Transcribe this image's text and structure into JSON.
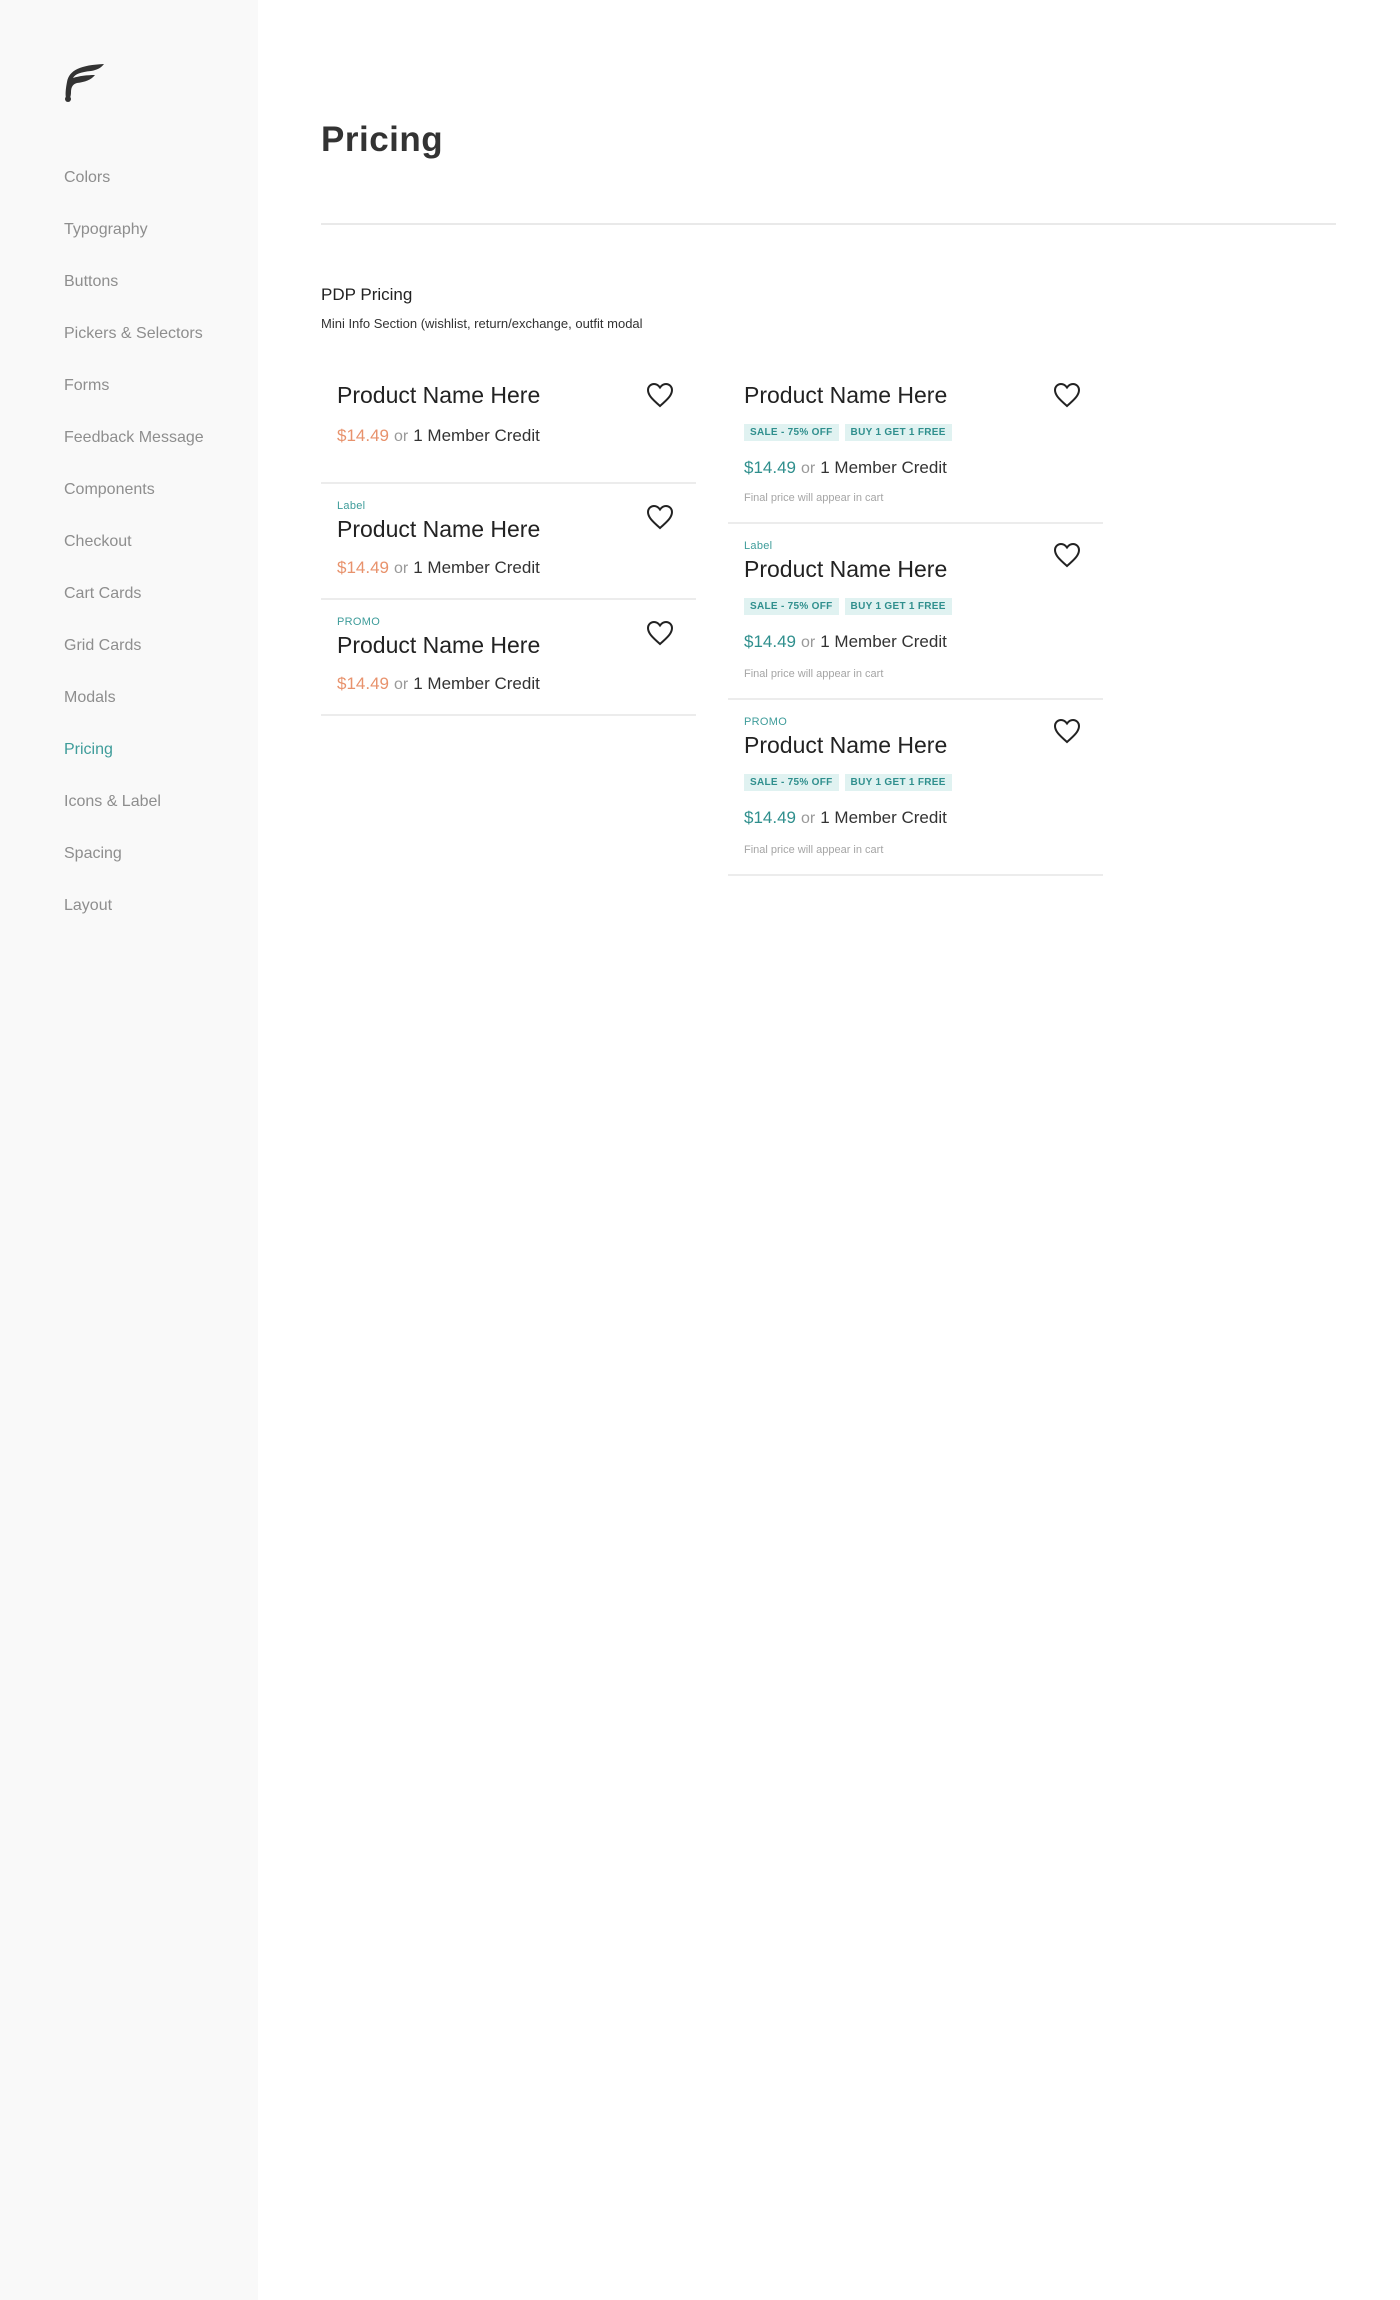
{
  "sidebar": {
    "logo_icon": "brand-feather-logo",
    "items": [
      {
        "label": "Colors",
        "active": false
      },
      {
        "label": "Typography",
        "active": false
      },
      {
        "label": "Buttons",
        "active": false
      },
      {
        "label": "Pickers & Selectors",
        "active": false
      },
      {
        "label": "Forms",
        "active": false
      },
      {
        "label": "Feedback Message",
        "active": false
      },
      {
        "label": "Components",
        "active": false
      },
      {
        "label": "Checkout",
        "active": false
      },
      {
        "label": "Cart Cards",
        "active": false
      },
      {
        "label": "Grid Cards",
        "active": false
      },
      {
        "label": "Modals",
        "active": false
      },
      {
        "label": "Pricing",
        "active": true
      },
      {
        "label": "Icons & Label",
        "active": false
      },
      {
        "label": "Spacing",
        "active": false
      },
      {
        "label": "Layout",
        "active": false
      }
    ]
  },
  "main": {
    "title": "Pricing",
    "section_title": "PDP Pricing",
    "section_subtitle": "Mini Info Section (wishlist, return/exchange, outfit modal",
    "left_cards": [
      {
        "label": "",
        "name": "Product Name Here",
        "price": "$14.49",
        "or": "or",
        "credit": "1 Member Credit"
      },
      {
        "label": "Label",
        "name": "Product Name Here",
        "price": "$14.49",
        "or": "or",
        "credit": "1 Member Credit"
      },
      {
        "label": "PROMO",
        "name": "Product Name Here",
        "price": "$14.49",
        "or": "or",
        "credit": "1 Member Credit"
      }
    ],
    "right_cards": [
      {
        "label": "",
        "name": "Product Name Here",
        "badges": [
          "SALE - 75% OFF",
          "BUY 1 GET 1 FREE"
        ],
        "price": "$14.49",
        "or": "or",
        "credit": "1 Member Credit",
        "note": "Final price will appear in cart"
      },
      {
        "label": "Label",
        "name": "Product Name Here",
        "badges": [
          "SALE - 75% OFF",
          "BUY 1 GET 1 FREE"
        ],
        "price": "$14.49",
        "or": "or",
        "credit": "1 Member Credit",
        "note": "Final price will appear in cart"
      },
      {
        "label": "PROMO",
        "name": "Product Name Here",
        "badges": [
          "SALE - 75% OFF",
          "BUY 1 GET 1 FREE"
        ],
        "price": "$14.49",
        "or": "or",
        "credit": "1 Member Credit",
        "note": "Final price will appear in cart"
      }
    ],
    "heart_icon": "heart-outline-icon"
  },
  "colors": {
    "accent": "#3e9c9a",
    "sale_price": "#e8926c",
    "member_price": "#2f8f8d",
    "badge_bg": "#e0f2f1"
  }
}
